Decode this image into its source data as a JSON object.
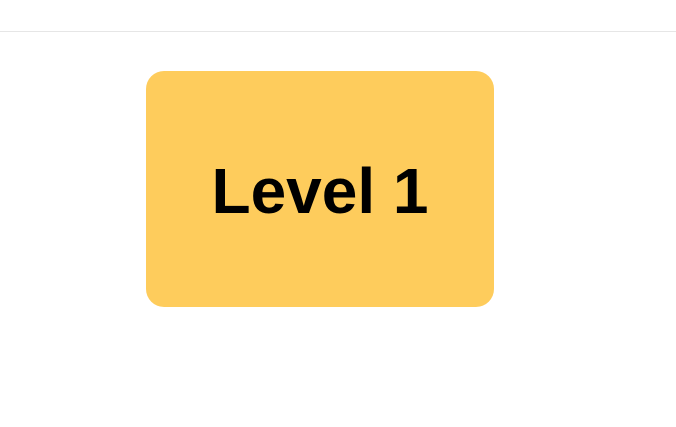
{
  "level_card": {
    "label": "Level 1",
    "background_color": "#fecc5c",
    "text_color": "#000000"
  },
  "divider_color": "#e6e6e6",
  "page_background": "#ffffff"
}
